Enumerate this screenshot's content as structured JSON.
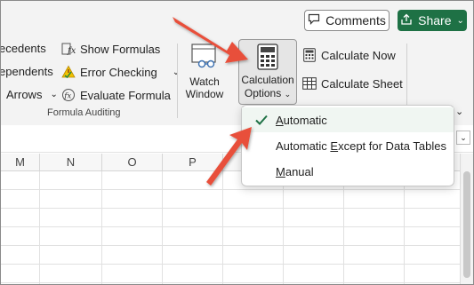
{
  "header": {
    "comments_label": "Comments",
    "share_label": "Share",
    "share_color": "#1e7145"
  },
  "ribbon": {
    "formula_auditing": {
      "items": [
        {
          "label": "ecedents",
          "icon": "trace-precedents-icon"
        },
        {
          "label": "ependents",
          "icon": "trace-dependents-icon"
        },
        {
          "label": "Arrows",
          "icon": "remove-arrows-icon"
        },
        {
          "label": "Show Formulas",
          "icon": "show-formulas-icon"
        },
        {
          "label": "Error Checking",
          "icon": "error-checking-icon"
        },
        {
          "label": "Evaluate Formula",
          "icon": "evaluate-formula-icon"
        }
      ],
      "group_label": "Formula Auditing"
    },
    "watch_window": {
      "line1": "Watch",
      "line2": "Window"
    },
    "calculation_options": {
      "line1": "Calculation",
      "line2": "Options"
    },
    "calculate_now": "Calculate Now",
    "calculate_sheet": "Calculate Sheet"
  },
  "grid": {
    "columns": [
      "M",
      "N",
      "O",
      "P"
    ]
  },
  "menu": {
    "items": [
      {
        "label": "Automatic",
        "underline_char": "A",
        "selected": true
      },
      {
        "label": "Automatic Except for Data Tables",
        "underline_char": "E",
        "selected": false
      },
      {
        "label": "Manual",
        "underline_char": "M",
        "selected": false
      }
    ],
    "check_color": "#1e7145"
  },
  "annotation": {
    "arrow_color": "#e8503a"
  }
}
